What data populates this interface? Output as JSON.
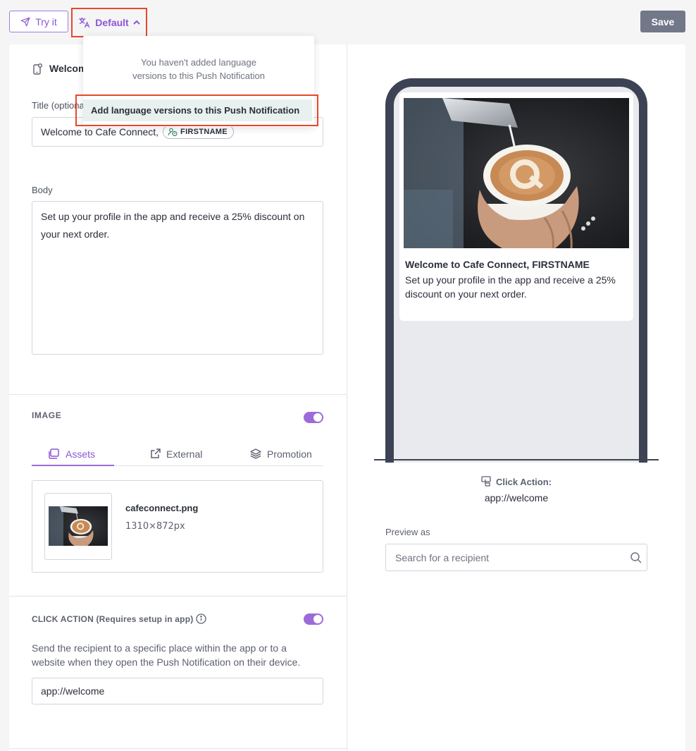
{
  "toolbar": {
    "try_label": "Try it",
    "language_label": "Default",
    "save_label": "Save"
  },
  "language_dropdown": {
    "message_line1": "You haven't added language",
    "message_line2": "versions to this Push Notification",
    "add_action": "Add language versions to this Push Notification"
  },
  "editor": {
    "header_title": "Welcome to Cafe Connect",
    "title_label": "Title (optional)",
    "title_value": "Welcome to Cafe Connect,",
    "title_tag": "FIRSTNAME",
    "body_label": "Body",
    "body_line1": "Set up your profile in the app and receive a 25% discount on",
    "body_line2": "your next order.",
    "image": {
      "section_label": "IMAGE",
      "enabled": true,
      "tabs": [
        {
          "label": "Assets",
          "icon": "assets-icon",
          "active": true
        },
        {
          "label": "External",
          "icon": "external-link-icon",
          "active": false
        },
        {
          "label": "Promotion",
          "icon": "layers-icon",
          "active": false
        }
      ],
      "file_name": "cafeconnect.png",
      "file_size": "1310×872px"
    },
    "click_action": {
      "section_label": "CLICK ACTION (Requires setup in app)",
      "enabled": true,
      "description_line1": "Send the recipient to a specific place within the app or to a",
      "description_line2": "website when they open the Push Notification on their device.",
      "value": "app://welcome"
    }
  },
  "preview": {
    "notification_title": "Welcome to Cafe Connect, FIRSTNAME",
    "notification_body_line1": "Set up your profile in the app and receive a 25%",
    "notification_body_line2": "discount on your next order.",
    "click_action_label": "Click Action:",
    "click_action_value": "app://welcome",
    "preview_as_label": "Preview as",
    "search_placeholder": "Search for a recipient"
  },
  "colors": {
    "accent": "#8c55d6",
    "highlight": "#e8472a",
    "phone_frame": "#3d4354",
    "save_button": "#737889"
  }
}
